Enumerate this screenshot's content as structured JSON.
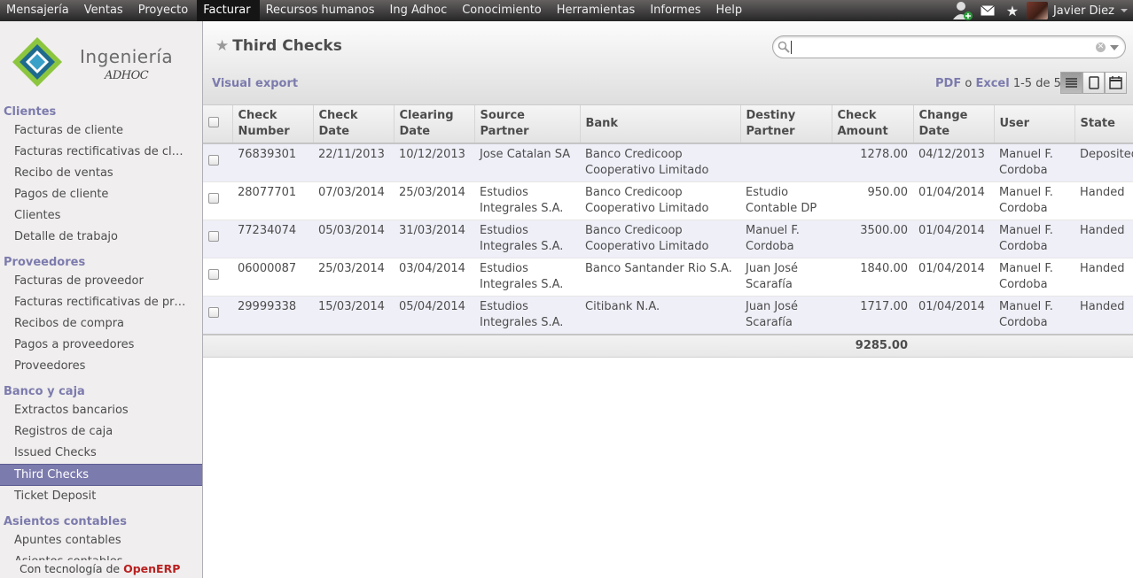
{
  "topbar": {
    "menu": [
      "Mensajería",
      "Ventas",
      "Proyecto",
      "Facturar",
      "Recursos humanos",
      "Ing Adhoc",
      "Conocimiento",
      "Herramientas",
      "Informes",
      "Help"
    ],
    "active_index": 3,
    "user_name": "Javier Diez"
  },
  "sidebar": {
    "logo_line1": "Ingeniería",
    "logo_line2": "ADHOC",
    "sections": [
      {
        "title": "Clientes",
        "items": [
          "Facturas de cliente",
          "Facturas rectificativas de cl…",
          "Recibo de ventas",
          "Pagos de cliente",
          "Clientes",
          "Detalle de trabajo"
        ]
      },
      {
        "title": "Proveedores",
        "items": [
          "Facturas de proveedor",
          "Facturas rectificativas de pr…",
          "Recibos de compra",
          "Pagos a proveedores",
          "Proveedores"
        ]
      },
      {
        "title": "Banco y caja",
        "items": [
          "Extractos bancarios",
          "Registros de caja",
          "Issued Checks",
          "Third Checks",
          "Ticket Deposit"
        ]
      },
      {
        "title": "Asientos contables",
        "items": [
          "Apuntes contables",
          "Asientos contables"
        ]
      }
    ],
    "active_item": "Third Checks",
    "powered_prefix": "Con tecnología de",
    "powered_brand": "OpenERP"
  },
  "main": {
    "title": "Third Checks",
    "search_value": "",
    "visual_export": "Visual export",
    "pager": {
      "pdf": "PDF",
      "or": "o",
      "excel": "Excel",
      "range": "1-5 de 5"
    }
  },
  "table": {
    "columns": [
      "Check Number",
      "Check Date",
      "Clearing Date",
      "Source Partner",
      "Bank",
      "Destiny Partner",
      "Check Amount",
      "Change Date",
      "User",
      "State"
    ],
    "rows": [
      [
        "76839301",
        "22/11/2013",
        "10/12/2013",
        "Jose Catalan SA",
        "Banco Credicoop Cooperativo Limitado",
        "",
        "1278.00",
        "04/12/2013",
        "Manuel F. Cordoba",
        "Deposited"
      ],
      [
        "28077701",
        "07/03/2014",
        "25/03/2014",
        "Estudios Integrales S.A.",
        "Banco Credicoop Cooperativo Limitado",
        "Estudio Contable DP",
        "950.00",
        "01/04/2014",
        "Manuel F. Cordoba",
        "Handed"
      ],
      [
        "77234074",
        "05/03/2014",
        "31/03/2014",
        "Estudios Integrales S.A.",
        "Banco Credicoop Cooperativo Limitado",
        "Manuel F. Cordoba",
        "3500.00",
        "01/04/2014",
        "Manuel F. Cordoba",
        "Handed"
      ],
      [
        "06000087",
        "25/03/2014",
        "03/04/2014",
        "Estudios Integrales S.A.",
        "Banco Santander Rio S.A.",
        "Juan José Scarafía",
        "1840.00",
        "01/04/2014",
        "Manuel F. Cordoba",
        "Handed"
      ],
      [
        "29999338",
        "15/03/2014",
        "05/04/2014",
        "Estudios Integrales S.A.",
        "Citibank N.A.",
        "Juan José Scarafía",
        "1717.00",
        "01/04/2014",
        "Manuel F. Cordoba",
        "Handed"
      ]
    ],
    "total_amount": "9285.00"
  }
}
